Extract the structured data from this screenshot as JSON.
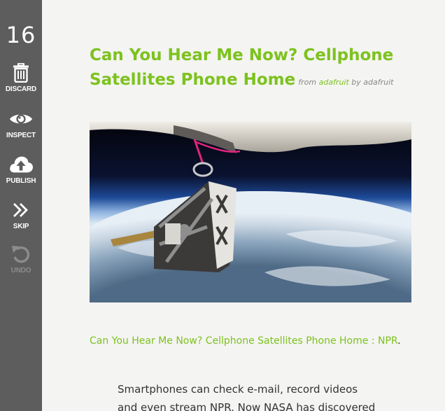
{
  "sidebar": {
    "count": "16",
    "actions": {
      "discard": {
        "label": "DISCARD",
        "icon": "trash-icon"
      },
      "inspect": {
        "label": "INSPECT",
        "icon": "eye-icon"
      },
      "publish": {
        "label": "PUBLISH",
        "icon": "cloud-upload-icon"
      },
      "skip": {
        "label": "SKIP",
        "icon": "double-chevron-right-icon"
      },
      "undo": {
        "label": "UNDO",
        "icon": "undo-icon"
      }
    }
  },
  "post": {
    "title": "Can You Hear Me Now? Cellphone Satellites Phone Home",
    "from_prefix": "from",
    "source": "adafruit",
    "by_prefix": "by",
    "author": "adafruit",
    "link_text": "Can You Hear Me Now? Cellphone Satellites Phone Home : NPR",
    "link_suffix": ".",
    "body_line_1": "Smartphones can check e-mail, record videos",
    "body_line_2": "and even stream NPR. Now NASA has discovered"
  },
  "colors": {
    "accent": "#7dc21e",
    "sidebar_bg": "#5d5d5d",
    "page_bg": "#f4f4f2"
  }
}
